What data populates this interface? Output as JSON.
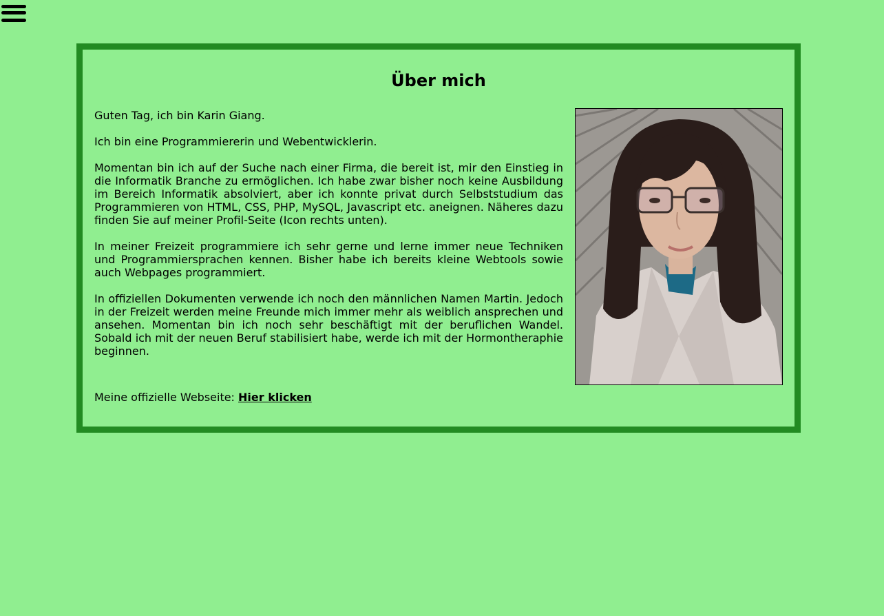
{
  "menu": {
    "icon": "hamburger-menu-icon"
  },
  "about": {
    "title": "Über mich",
    "paragraphs": [
      "Guten Tag, ich bin Karin Giang.",
      "Ich bin eine Programmiererin und Webentwicklerin.",
      "Momentan bin ich auf der Suche nach einer Firma, die bereit ist, mir den Einstieg in die Informatik Branche zu ermöglichen. Ich habe zwar bisher noch keine Ausbildung im Bereich Informatik absolviert, aber ich konnte privat durch Selbststudium das Programmieren von HTML, CSS, PHP, MySQL, Javascript etc. aneignen. Näheres dazu finden Sie auf meiner Profil-Seite (Icon rechts unten).",
      "In meiner Freizeit programmiere ich sehr gerne und lerne immer neue Techniken und Programmiersprachen kennen. Bisher habe ich bereits kleine Webtools sowie auch Webpages programmiert.",
      "In offiziellen Dokumenten verwende ich noch den männlichen Namen Martin. Jedoch in der Freizeit werden meine Freunde mich immer mehr als weiblich ansprechen und ansehen. Momentan bin ich noch sehr beschäftigt mit der beruflichen Wandel. Sobald ich mit der neuen Beruf stabilisiert habe, werde ich mit der Hormontheraphie beginnen."
    ],
    "website_label": "Meine offizielle Webseite: ",
    "website_link": "Hier klicken"
  },
  "colors": {
    "background": "#90ee90",
    "panel_border": "#228b22"
  }
}
